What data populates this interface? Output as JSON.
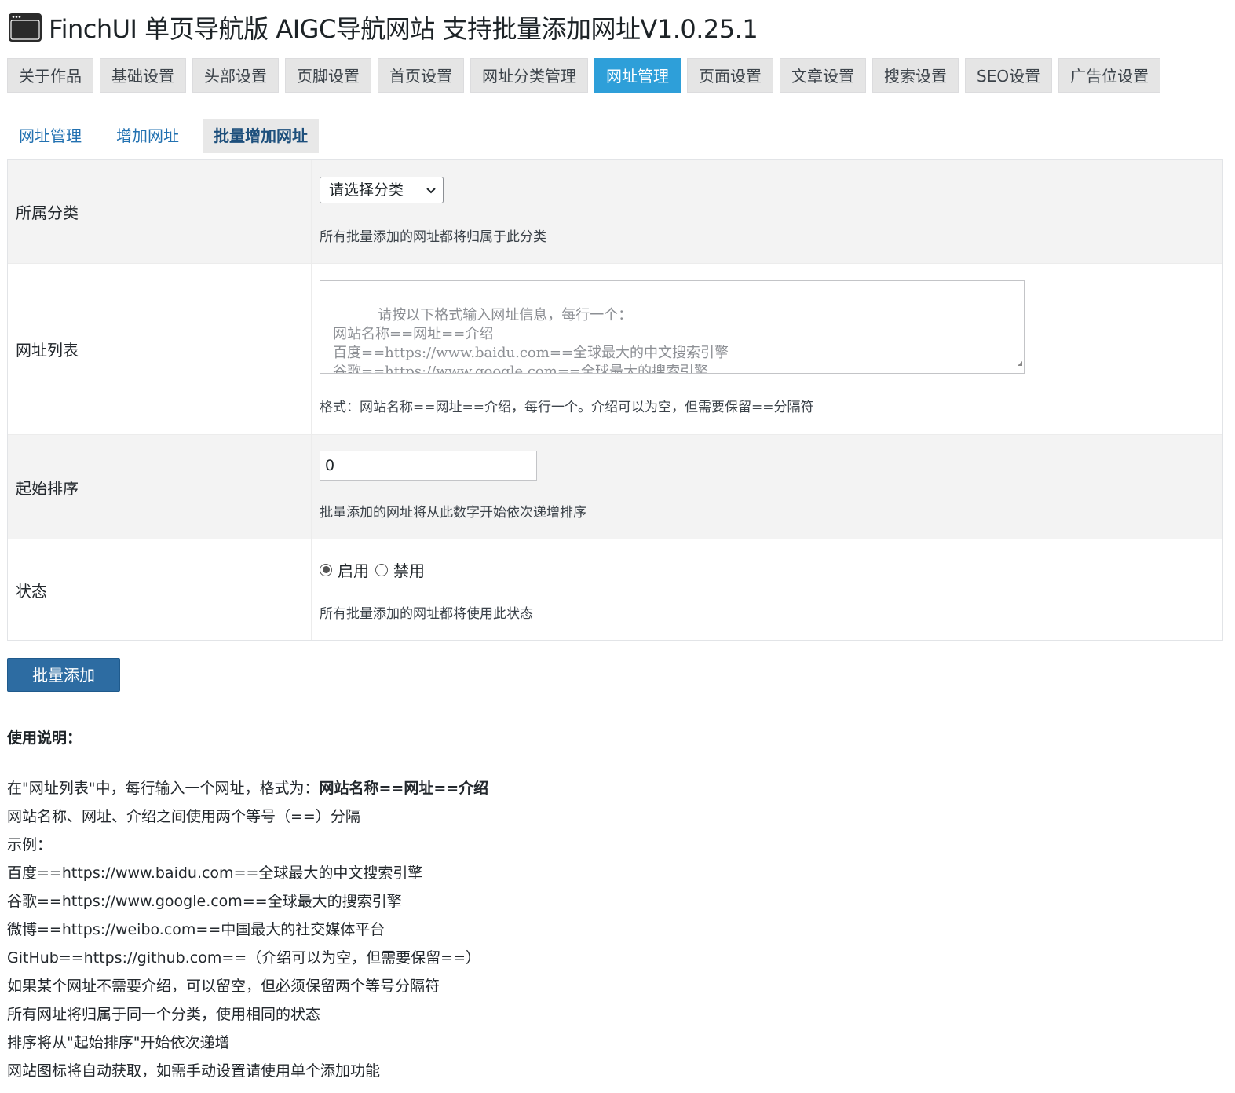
{
  "header": {
    "title": "FinchUI 单页导航版 AIGC导航网站 支持批量添加网址V1.0.25.1",
    "icon": "window-icon"
  },
  "main_tabs": [
    {
      "label": "关于作品",
      "active": false
    },
    {
      "label": "基础设置",
      "active": false
    },
    {
      "label": "头部设置",
      "active": false
    },
    {
      "label": "页脚设置",
      "active": false
    },
    {
      "label": "首页设置",
      "active": false
    },
    {
      "label": "网址分类管理",
      "active": false
    },
    {
      "label": "网址管理",
      "active": true
    },
    {
      "label": "页面设置",
      "active": false
    },
    {
      "label": "文章设置",
      "active": false
    },
    {
      "label": "搜索设置",
      "active": false
    },
    {
      "label": "SEO设置",
      "active": false
    },
    {
      "label": "广告位设置",
      "active": false
    }
  ],
  "sub_tabs": [
    {
      "label": "网址管理",
      "active": false
    },
    {
      "label": "增加网址",
      "active": false
    },
    {
      "label": "批量增加网址",
      "active": true
    }
  ],
  "form": {
    "category": {
      "label": "所属分类",
      "selected": "请选择分类",
      "help": "所有批量添加的网址都将归属于此分类"
    },
    "url_list": {
      "label": "网址列表",
      "placeholder": "请按以下格式输入网址信息，每行一个：\n网站名称==网址==介绍\n百度==https://www.baidu.com==全球最大的中文搜索引擎\n谷歌==https://www.google.com==全球最大的搜索引擎",
      "help": "格式：网站名称==网址==介绍，每行一个。介绍可以为空，但需要保留==分隔符"
    },
    "start_order": {
      "label": "起始排序",
      "value": "0",
      "help": "批量添加的网址将从此数字开始依次递增排序"
    },
    "status": {
      "label": "状态",
      "options": [
        {
          "label": "启用",
          "checked": true
        },
        {
          "label": "禁用",
          "checked": false
        }
      ],
      "help": "所有批量添加的网址都将使用此状态"
    }
  },
  "submit_label": "批量添加",
  "instructions": {
    "title": "使用说明：",
    "line1_prefix": "在\"网址列表\"中，每行输入一个网址，格式为：",
    "line1_bold": "网站名称==网址==介绍",
    "lines": [
      "网站名称、网址、介绍之间使用两个等号（==）分隔",
      "示例：",
      "百度==https://www.baidu.com==全球最大的中文搜索引擎",
      "谷歌==https://www.google.com==全球最大的搜索引擎",
      "微博==https://weibo.com==中国最大的社交媒体平台",
      "GitHub==https://github.com==（介绍可以为空，但需要保留==）",
      "如果某个网址不需要介绍，可以留空，但必须保留两个等号分隔符",
      "所有网址将归属于同一个分类，使用相同的状态",
      "排序将从\"起始排序\"开始依次递增",
      "网站图标将自动获取，如需手动设置请使用单个添加功能"
    ]
  },
  "colors": {
    "active_tab": "#2e9fd9",
    "button": "#2d6ca2",
    "link": "#2271b1"
  }
}
